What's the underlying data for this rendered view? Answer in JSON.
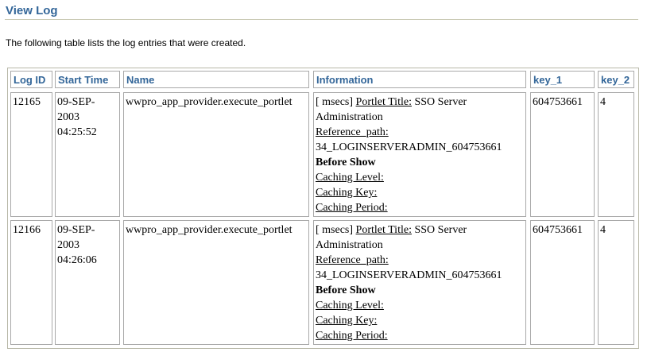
{
  "page": {
    "title": "View Log",
    "intro": "The following table lists the log entries that were created."
  },
  "table": {
    "headers": [
      "Log ID",
      "Start Time",
      "Name",
      "Information",
      "key_1",
      "key_2"
    ],
    "rows": [
      {
        "log_id": "12165",
        "start_date": "09-SEP-",
        "start_year": "2003",
        "start_time": "04:25:52",
        "name": "wwpro_app_provider.execute_portlet",
        "info": {
          "prefix": "[ msecs]",
          "portlet_title_label": "Portlet Title:",
          "portlet_title_value": "SSO Server",
          "portlet_title_value2": "Administration",
          "reference_path_label": "Reference_path:",
          "reference_path_value": "34_LOGINSERVERADMIN_604753661",
          "phase": "Before Show",
          "caching_level_label": "Caching Level:",
          "caching_key_label": "Caching Key:",
          "caching_period_label": "Caching Period:"
        },
        "key_1": "604753661",
        "key_2": "4"
      },
      {
        "log_id": "12166",
        "start_date": "09-SEP-",
        "start_year": "2003",
        "start_time": "04:26:06",
        "name": "wwpro_app_provider.execute_portlet",
        "info": {
          "prefix": "[ msecs]",
          "portlet_title_label": "Portlet Title:",
          "portlet_title_value": "SSO Server",
          "portlet_title_value2": "Administration",
          "reference_path_label": "Reference_path:",
          "reference_path_value": "34_LOGINSERVERADMIN_604753661",
          "phase": "Before Show",
          "caching_level_label": "Caching Level:",
          "caching_key_label": "Caching Key:",
          "caching_period_label": "Caching Period:"
        },
        "key_1": "604753661",
        "key_2": "4"
      }
    ]
  },
  "colors": {
    "title": "#336699",
    "header_text": "#336699",
    "border": "#a9a9a9",
    "rule": "#c9c9b3"
  }
}
